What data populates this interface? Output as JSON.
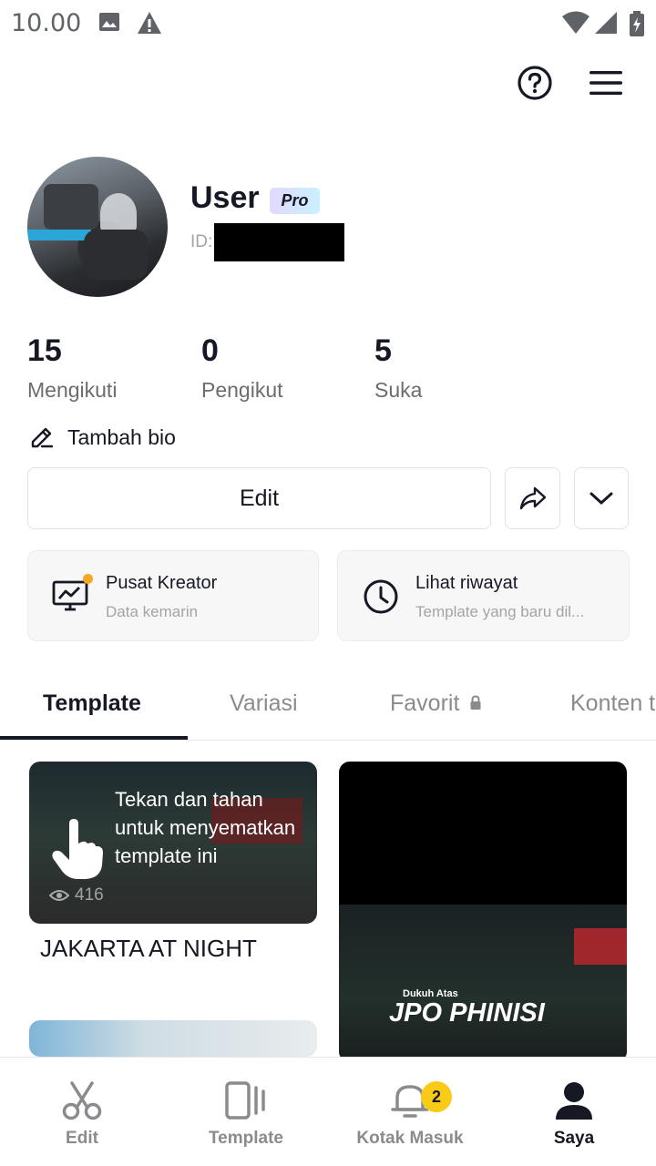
{
  "status_bar": {
    "time": "10.00"
  },
  "profile": {
    "username": "User",
    "badge": "Pro",
    "id_prefix": "ID:"
  },
  "stats": [
    {
      "value": "15",
      "label": "Mengikuti"
    },
    {
      "value": "0",
      "label": "Pengikut"
    },
    {
      "value": "5",
      "label": "Suka"
    }
  ],
  "bio_label": "Tambah bio",
  "actions": {
    "edit_label": "Edit"
  },
  "cards": [
    {
      "title": "Pusat Kreator",
      "subtitle": "Data kemarin",
      "icon": "creator-monitor-icon"
    },
    {
      "title": "Lihat riwayat",
      "subtitle": "Template yang baru dil...",
      "icon": "clock-icon"
    }
  ],
  "tabs": [
    {
      "label": "Template",
      "active": true
    },
    {
      "label": "Variasi",
      "active": false
    },
    {
      "label": "Favorit",
      "active": false,
      "locked": true
    },
    {
      "label": "Konten t",
      "active": false
    }
  ],
  "grid": {
    "item1": {
      "views": "416",
      "tooltip": "Tekan dan tahan untuk menyematkan template ini",
      "title": "JAKARTA AT NIGHT"
    },
    "item2": {
      "overlay_small": "Dukuh Atas",
      "overlay_big": "JPO PHINISI"
    }
  },
  "bottom_nav": [
    {
      "label": "Edit",
      "icon": "scissors-icon",
      "active": false
    },
    {
      "label": "Template",
      "icon": "template-icon",
      "active": false
    },
    {
      "label": "Kotak Masuk",
      "icon": "bell-icon",
      "active": false,
      "badge": "2"
    },
    {
      "label": "Saya",
      "icon": "person-icon",
      "active": true
    }
  ]
}
